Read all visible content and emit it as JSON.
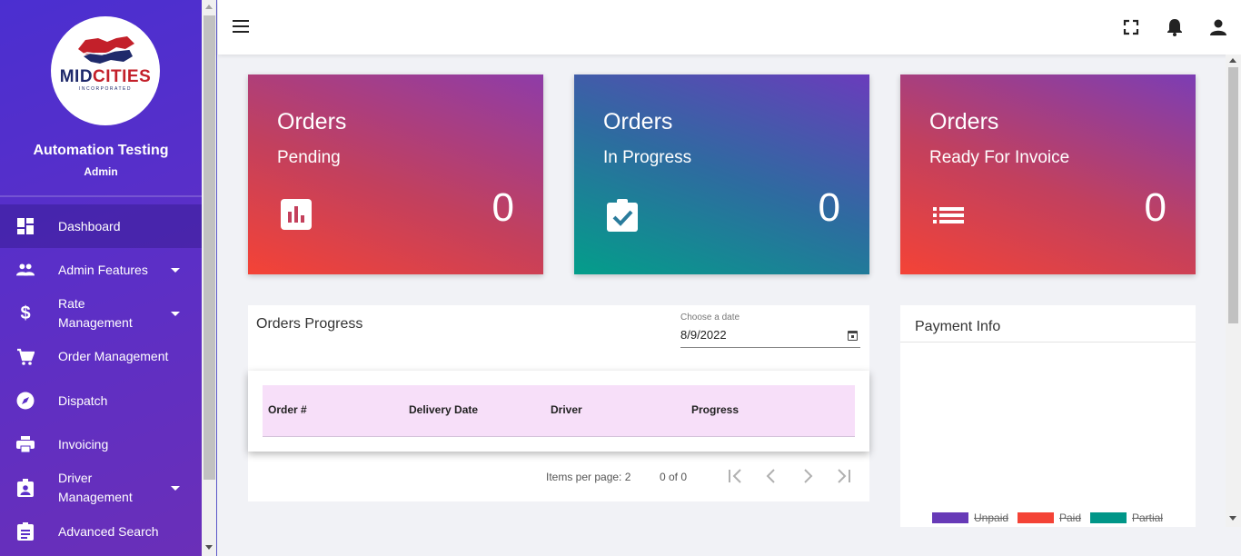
{
  "brand": {
    "name_part1": "MID",
    "name_part2": "CITIES",
    "tagline": "INCORPORATED"
  },
  "user": {
    "name": "Automation Testing",
    "role": "Admin"
  },
  "sidebar": {
    "items": [
      {
        "label": "Dashboard",
        "icon": "dashboard-icon",
        "active": true
      },
      {
        "label": "Admin Features",
        "icon": "people-icon",
        "expandable": true
      },
      {
        "label": "Rate\nManagement",
        "line1": "Rate",
        "line2": "Management",
        "icon": "dollar-icon",
        "expandable": true
      },
      {
        "label": "Order Management",
        "icon": "cart-icon"
      },
      {
        "label": "Dispatch",
        "icon": "compass-icon"
      },
      {
        "label": "Invoicing",
        "icon": "printer-icon"
      },
      {
        "label": "Driver\nManagement",
        "line1": "Driver",
        "line2": "Management",
        "icon": "badge-icon",
        "expandable": true
      },
      {
        "label": "Advanced Search",
        "icon": "clipboard-icon"
      }
    ]
  },
  "topbar": {
    "icons": [
      "menu-icon",
      "fullscreen-icon",
      "bell-icon",
      "account-icon"
    ]
  },
  "cards": [
    {
      "title": "Orders",
      "subtitle": "Pending",
      "value": "0",
      "icon": "bar-chart-icon"
    },
    {
      "title": "Orders",
      "subtitle": "In Progress",
      "value": "0",
      "icon": "clipboard-check-icon"
    },
    {
      "title": "Orders",
      "subtitle": "Ready For Invoice",
      "value": "0",
      "icon": "list-icon"
    }
  ],
  "orders_progress": {
    "title": "Orders Progress",
    "date_label": "Choose a date",
    "date_value": "8/9/2022",
    "columns": [
      "Order #",
      "Delivery Date",
      "Driver",
      "Progress"
    ],
    "items_per_page_label": "Items per page:",
    "items_per_page": "2",
    "range": "0 of 0"
  },
  "payment_info": {
    "title": "Payment Info",
    "legend": [
      {
        "label": "Unpaid",
        "color": "#673ab7"
      },
      {
        "label": "Paid",
        "color": "#f44336"
      },
      {
        "label": "Partial",
        "color": "#009688"
      }
    ]
  },
  "colors": {
    "sidebar": "#5a2fc8",
    "table_header": "#f7dff9"
  }
}
